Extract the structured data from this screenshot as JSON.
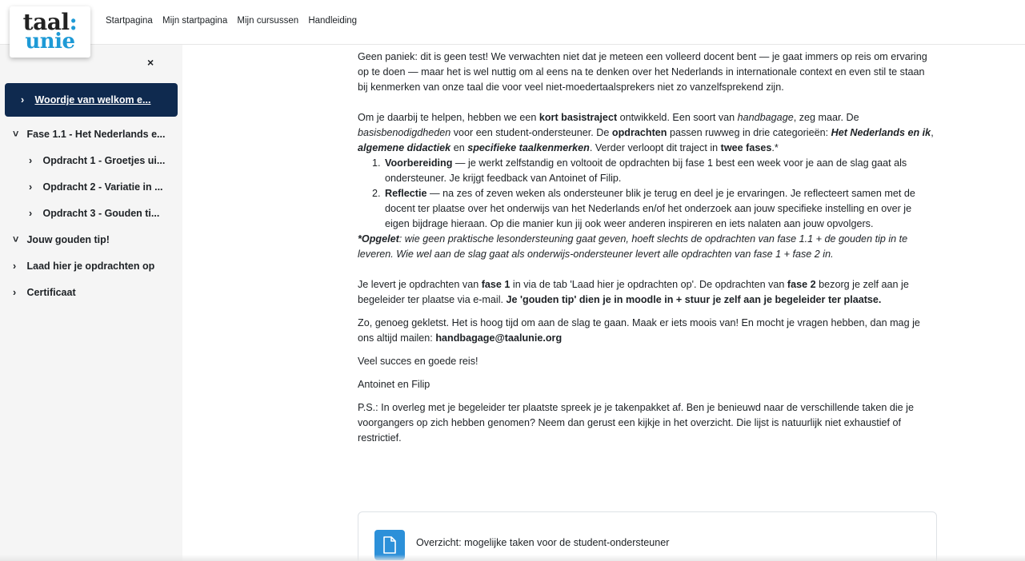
{
  "logo": {
    "top": "taal",
    "colon": ":",
    "bottom": "unie"
  },
  "navbar": {
    "links": [
      "Startpagina",
      "Mijn startpagina",
      "Mijn cursussen",
      "Handleiding"
    ]
  },
  "drawer": {
    "close_glyph": "×",
    "items": [
      {
        "chevron": "›",
        "label": "Woordje van welkom e..."
      },
      {
        "chevron": "˅",
        "label": "Fase 1.1 - Het Nederlands e..."
      },
      {
        "chevron": "›",
        "label": "Opdracht 1 - Groetjes ui..."
      },
      {
        "chevron": "›",
        "label": "Opdracht 2 - Variatie in ..."
      },
      {
        "chevron": "›",
        "label": "Opdracht 3 - Gouden ti..."
      },
      {
        "chevron": "˅",
        "label": "Jouw gouden tip!"
      },
      {
        "chevron": "›",
        "label": "Laad hier je opdrachten op"
      },
      {
        "chevron": "›",
        "label": "Certificaat"
      }
    ]
  },
  "content": {
    "p1": "Geen paniek: dit is geen test! We verwachten niet dat je meteen een volleerd docent bent — je gaat immers op reis om ervaring op te doen — maar het is wel nuttig om al eens na te denken over het Nederlands in internationale context en even stil te staan bij kenmerken van onze taal die voor veel niet-moedertaalsprekers niet zo vanzelfsprekend zijn.",
    "p2": {
      "a": "Om je daarbij te helpen, hebben we een ",
      "b": "kort basistraject",
      "c": " ontwikkeld. Een soort van ",
      "d": "handbagage",
      "e": ", zeg maar. De ",
      "f": "basisbenodigdheden",
      "g": " voor een student-ondersteuner. De ",
      "h": "opdrachten",
      "i": " passen ruwweg in drie categorieën: ",
      "j": "Het Nederlands en ik",
      "k": ", ",
      "l": "algemene didactiek",
      "m": " en ",
      "n": "specifieke taalkenmerken",
      "o": ". Verder verloopt dit traject in ",
      "p": "twee fases",
      "q": ".*"
    },
    "list": [
      {
        "bold": "Voorbereiding",
        "text": " — je werkt zelfstandig en voltooit de opdrachten bij fase 1 best een week voor je aan de slag gaat als ondersteuner.  Je krijgt feedback van Antoinet of Filip."
      },
      {
        "bold": "Reflectie",
        "text": " — na zes of zeven weken als ondersteuner blik je terug en deel je je ervaringen. Je reflecteert samen met de docent ter plaatse over het onderwijs van het Nederlands en/of het onderzoek aan jouw specifieke instelling en over je eigen bijdrage hieraan. Op die manier kun jij ook weer anderen inspireren en iets nalaten aan jouw opvolgers."
      }
    ],
    "note": {
      "bold": "*Opgelet",
      "text": ": wie geen praktische lesondersteuning gaat geven, hoeft slechts de opdrachten van fase 1.1 + de gouden tip in te leveren. Wie wel aan de slag gaat als onderwijs-ondersteuner levert alle opdrachten van fase 1 + fase 2 in."
    },
    "p3": {
      "a": "Je levert je opdrachten van ",
      "b": "fase 1",
      "c": " in via de tab 'Laad hier je opdrachten op'. De opdrachten van ",
      "d": "fase 2",
      "e": " bezorg je zelf aan je begeleider ter plaatse via e-mail. ",
      "f": "Je 'gouden tip' dien je in moodle in + stuur je zelf aan je begeleider ter plaatse."
    },
    "p4": {
      "a": "Zo, genoeg gekletst. Het is hoog tijd om aan de slag te gaan. Maak er iets moois van! En mocht je vragen hebben, dan mag je ons altijd mailen: ",
      "b": "handbagage@taalunie.org"
    },
    "p5": "Veel succes en goede reis!",
    "p6": "Antoinet en Filip",
    "p7": "P.S.: In overleg met je begeleider ter plaatste spreek je je takenpakket af. Ben je benieuwd naar de verschillende taken die je voorgangers op zich hebben genomen? Neem dan gerust een kijkje in het overzicht. Die lijst is natuurlijk niet exhaustief of restrictief."
  },
  "resource": {
    "icon": "file-icon",
    "title": "Overzicht: mogelijke taken voor de student-ondersteuner",
    "accent": "#2c90d9"
  },
  "colors": {
    "active_item_bg": "#0f2a4f",
    "drawer_bg": "#f5f5f5",
    "brand_blue": "#1e9ad6"
  }
}
